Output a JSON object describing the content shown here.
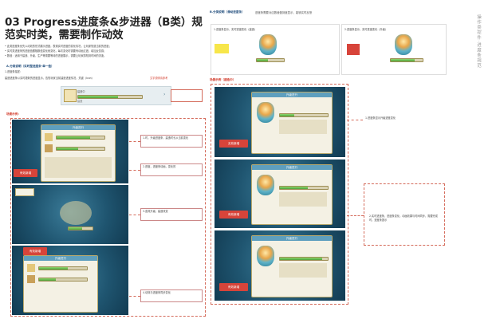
{
  "left": {
    "title": "03 Progress进度条&步进器（B类）规范实时类，需要制作动效",
    "intro_lines": [
      "• 此类进度条优先以动效的形式展示进度，表现实时进度的变化情况，让玩家知道当前的进度；",
      "• 实时类进度条的进度值跟随数值变化而变化，每次变化时需要有动画过渡，增加反馈感；",
      "• 数值：适用于建造、升级、生产等需要等待的进度展示，需要让玩家感知到时间的流逝。"
    ],
    "section_a": "A.分类说明（实时型进度条-单一值）",
    "section_a_sub": "1.进度条描述：",
    "section_a_desc": "建造进度条以实时更新的进度显示，告知玩家当前建造进度情况，关键（Icon）",
    "section_a_red": "文字说明请参考",
    "example": {
      "icon_label": "建造中",
      "caption": "建造",
      "action": "加速"
    },
    "group_label": "场景示例：",
    "shot1": {
      "header": "升级进行",
      "badge": "有效新增"
    },
    "shot3": {
      "header": "升级进行",
      "badge": "有效新增"
    },
    "notes": [
      "1.时，升级进度条，建造时长从当前变化",
      "2.进度，进度条动画，变化的",
      "3.道具升级，建造改变",
      "4.动效与进度条同步变化"
    ]
  },
  "right": {
    "section_b": "B.分类说明（滑动进度条）",
    "section_b_desc": "进度条需要对应数值做刻度显示、能够实时反馈",
    "ex_left": {
      "caption": "1.进度条显示，实时进度变化（建造）"
    },
    "ex_right": {
      "caption": "2.进度条显示，实时进度变化（升级）"
    },
    "group_label": "场景示例（建造中）",
    "shots": [
      {
        "header": "升级进行",
        "badge": "无效新增"
      },
      {
        "header": "升级进行",
        "badge": "有效新增"
      },
      {
        "header": "升级进行",
        "badge": "有效新增"
      }
    ],
    "notes": [
      "1.进度条显示升级进度变化",
      "2.实时进度条，进度条变化，动画效果与时间同步，需要完成时，进度条提示"
    ]
  },
  "vertical_text": "操作类控件·进度条规范",
  "colors": {
    "accent_red": "#d23a2a",
    "heading_blue": "#1d4a7a",
    "game_sea": "#1f5570"
  }
}
